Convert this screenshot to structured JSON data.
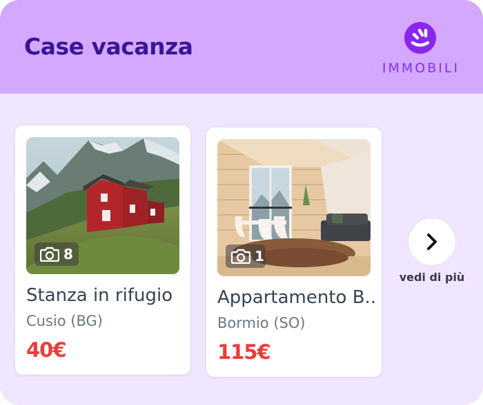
{
  "header": {
    "title": "Case vacanza",
    "brand_name": "IMMOBILI",
    "background_color": "#d5a8ff",
    "title_color": "#3a1597",
    "brand_color": "#8a25f0"
  },
  "listings": [
    {
      "title": "Stanza in rifugio",
      "location": "Cusio (BG)",
      "price": "40€",
      "photo_count": "8",
      "photo_icon": "camera-icon"
    },
    {
      "title": "Appartamento B..",
      "location": "Bormio (SO)",
      "price": "115€",
      "photo_count": "1",
      "photo_icon": "camera-icon"
    }
  ],
  "more": {
    "icon": "chevron-right-icon",
    "label": "vedi di più"
  },
  "colors": {
    "price": "#ed3b3b",
    "page_background": "#f1e6ff"
  }
}
